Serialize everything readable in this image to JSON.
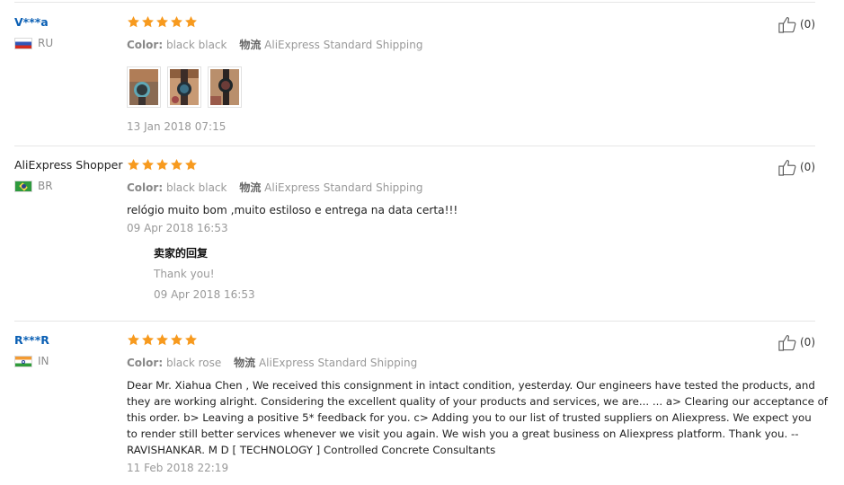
{
  "labels": {
    "color": "Color:",
    "shipping": "物流"
  },
  "reviews": [
    {
      "user": "V***a",
      "country": "RU",
      "color_value": "black black",
      "shipping_value": "AliExpress Standard Shipping",
      "date": "13 Jan 2018 07:15",
      "helpful_count": "(0)",
      "rating": 5
    },
    {
      "user": "AliExpress Shopper",
      "country": "BR",
      "color_value": "black black",
      "shipping_value": "AliExpress Standard Shipping",
      "text": "relógio muito bom ,muito estiloso e entrega na data certa!!!",
      "date": "09 Apr 2018 16:53",
      "helpful_count": "(0)",
      "rating": 5,
      "reply": {
        "title": "卖家的回复",
        "text": "Thank you!",
        "date": "09 Apr 2018 16:53"
      }
    },
    {
      "user": "R***R",
      "country": "IN",
      "color_value": "black rose",
      "shipping_value": "AliExpress Standard Shipping",
      "text_lines": [
        "Dear Mr. Xiahua Chen , We received this consignment in intact condition, yesterday. Our engineers have tested the products, and",
        "they are working alright. Considering the excellent quality of your products and services, we are... ... a> Clearing our acceptance of",
        "this order. b> Leaving a positive 5* feedback for you. c> Adding you to our list of trusted suppliers on Aliexpress. We expect you",
        "to render still better services whenever we visit you again. We wish you a great business on Aliexpress platform. Thank you. --",
        "RAVISHANKAR. M D [ TECHNOLOGY ] Controlled Concrete Consultants"
      ],
      "date": "11 Feb 2018 22:19",
      "helpful_count": "(0)",
      "rating": 5
    }
  ],
  "colors": {
    "star": "#f79a1e",
    "link": "#0a5fb4",
    "muted": "#999999"
  }
}
